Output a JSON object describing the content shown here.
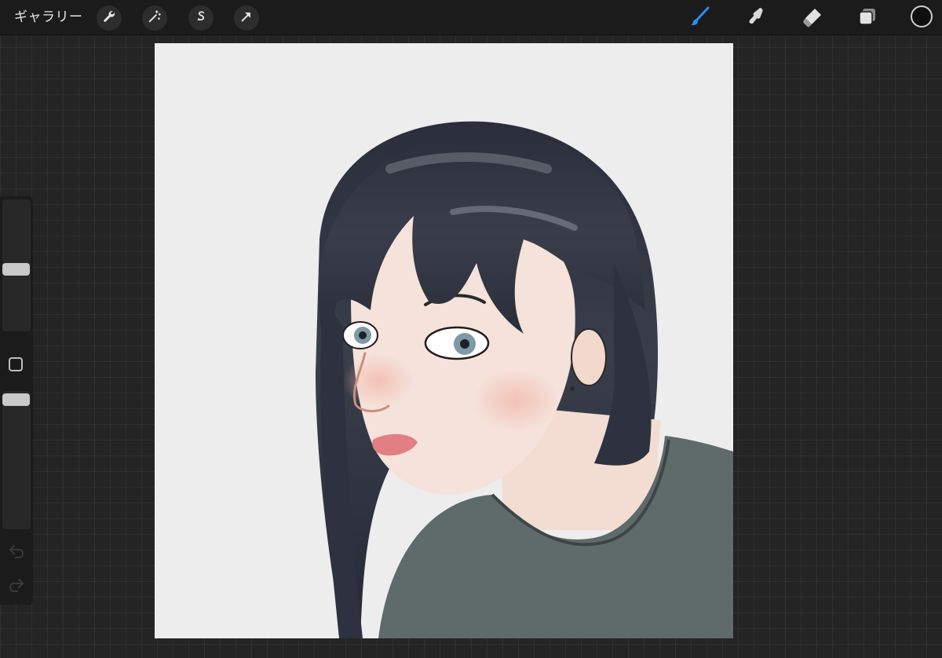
{
  "toolbar": {
    "gallery_label": "ギャラリー",
    "left_icons": [
      "wrench-icon",
      "magic-wand-icon",
      "selection-icon",
      "move-arrow-icon"
    ],
    "right_tools": [
      "brush-icon",
      "smudge-icon",
      "eraser-icon",
      "layers-icon"
    ],
    "active_tool": "brush",
    "active_color": "#0f0f0f",
    "accent_color": "#2d8cf0"
  },
  "sidebar": {
    "brush_size_level": 0.47,
    "brush_opacity_level": 0.98,
    "icons": [
      "modify-square-icon",
      "undo-icon",
      "redo-icon"
    ]
  },
  "canvas": {
    "paper_color": "#eeeded",
    "artwork": "portrait-illustration"
  }
}
